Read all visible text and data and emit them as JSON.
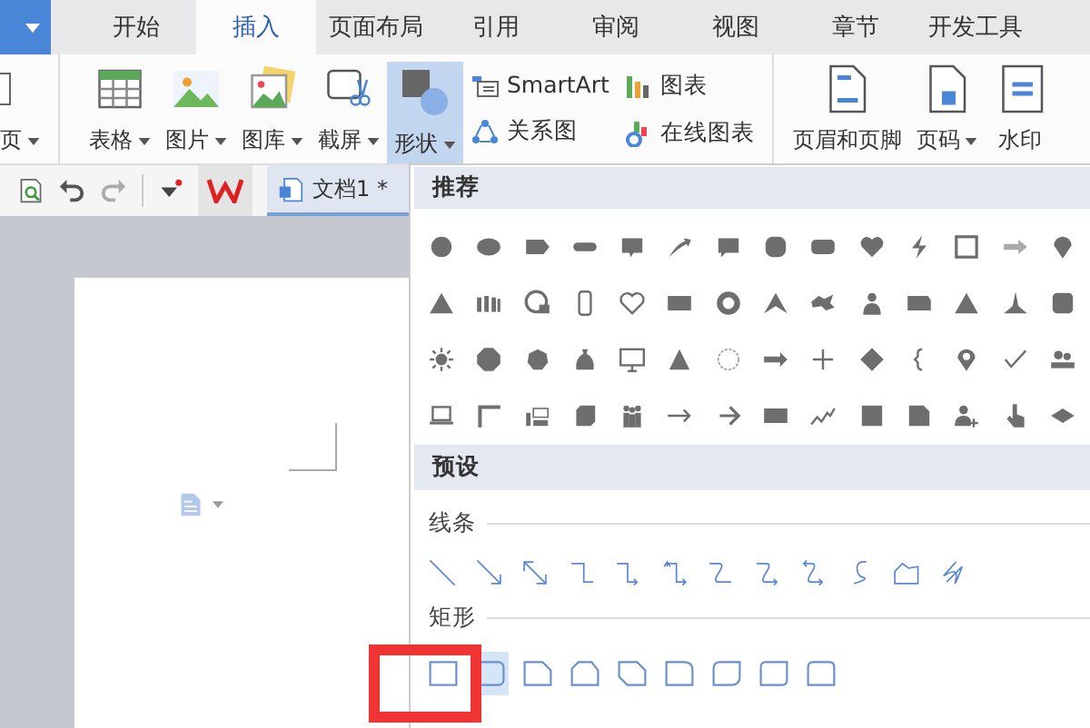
{
  "tabs": [
    {
      "label": "开始",
      "selected": false
    },
    {
      "label": "插入",
      "selected": true
    },
    {
      "label": "页面布局",
      "selected": false
    },
    {
      "label": "引用",
      "selected": false
    },
    {
      "label": "审阅",
      "selected": false
    },
    {
      "label": "视图",
      "selected": false
    },
    {
      "label": "章节",
      "selected": false
    },
    {
      "label": "开发工具",
      "selected": false
    }
  ],
  "ribbon_tools": [
    {
      "kind": "big",
      "label": "页",
      "dropdown": true,
      "selected": false
    },
    {
      "kind": "big",
      "label": "表格",
      "dropdown": true,
      "selected": false
    },
    {
      "kind": "big",
      "label": "图片",
      "dropdown": true,
      "selected": false
    },
    {
      "kind": "big",
      "label": "图库",
      "dropdown": true,
      "selected": false
    },
    {
      "kind": "big",
      "label": "截屏",
      "dropdown": true,
      "selected": false
    },
    {
      "kind": "big",
      "label": "形状",
      "dropdown": true,
      "selected": true
    },
    {
      "kind": "stack",
      "items": [
        {
          "label": "SmartArt"
        },
        {
          "label": "关系图"
        }
      ]
    },
    {
      "kind": "stack",
      "items": [
        {
          "label": "图表"
        },
        {
          "label": "在线图表"
        }
      ]
    },
    {
      "kind": "big",
      "label": "页眉和页脚",
      "dropdown": false,
      "selected": false
    },
    {
      "kind": "big",
      "label": "页码",
      "dropdown": true,
      "selected": false
    },
    {
      "kind": "big",
      "label": "水印",
      "dropdown": false,
      "selected": false
    }
  ],
  "document_tab": {
    "label": "文档1 *",
    "selected": true
  },
  "shapes_panel": {
    "recommended_header": "推荐",
    "presets_header": "预设",
    "lines_label": "线条",
    "rectangles_label": "矩形",
    "rectangles": [
      {
        "selected": false
      },
      {
        "selected": true
      },
      {
        "selected": false
      },
      {
        "selected": false
      },
      {
        "selected": false
      },
      {
        "selected": false
      },
      {
        "selected": false
      },
      {
        "selected": false
      },
      {
        "selected": false
      }
    ]
  }
}
